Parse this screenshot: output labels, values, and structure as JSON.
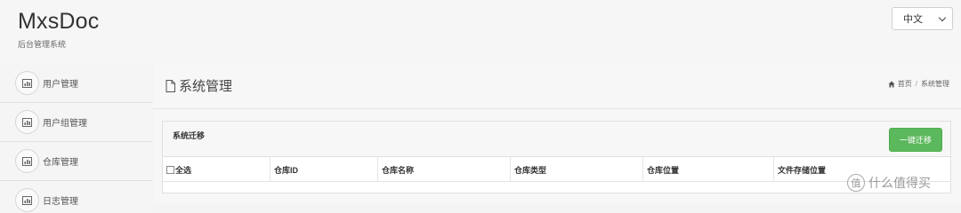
{
  "header": {
    "brand": "MxsDoc",
    "subtitle": "后台管理系统",
    "language": "中文"
  },
  "sidebar": {
    "items": [
      {
        "label": "用户管理",
        "icon": "bar-chart-icon"
      },
      {
        "label": "用户组管理",
        "icon": "bar-chart-icon"
      },
      {
        "label": "仓库管理",
        "icon": "bar-chart-icon"
      },
      {
        "label": "日志管理",
        "icon": "bar-chart-icon"
      }
    ]
  },
  "main": {
    "title": "系统管理",
    "breadcrumb": {
      "home": "首页",
      "current": "系统管理"
    },
    "panel": {
      "title": "系统迁移",
      "migrate_button": "一键迁移",
      "columns": [
        "全选",
        "仓库ID",
        "仓库名称",
        "仓库类型",
        "仓库位置",
        "文件存储位置"
      ]
    }
  },
  "watermark": {
    "circle_text": "值",
    "text": "什么值得买"
  },
  "colors": {
    "accent_green": "#5cb85c",
    "background": "#f4f4f4"
  }
}
